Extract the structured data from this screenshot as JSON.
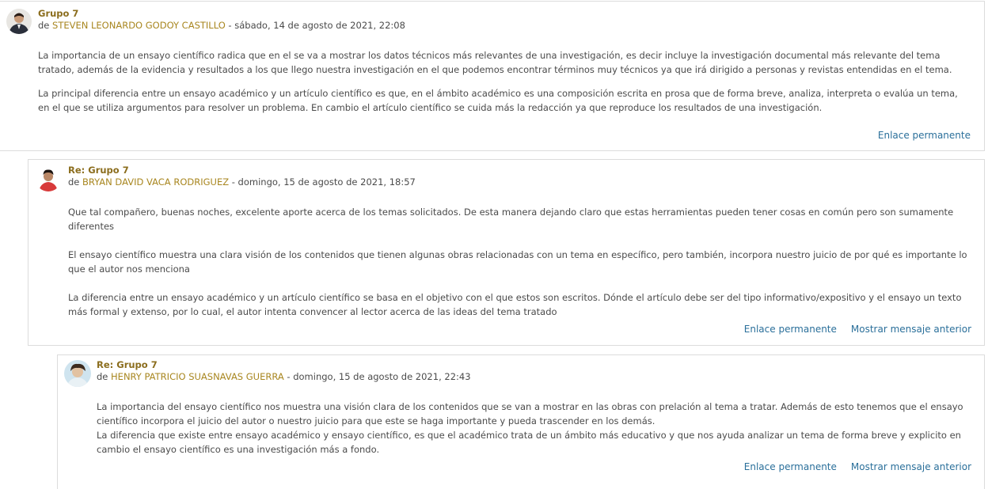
{
  "posts": [
    {
      "subject": "Grupo 7",
      "by_prefix": "de",
      "author": "STEVEN LEONARDO GODOY CASTILLO",
      "date": " - sábado, 14 de agosto de 2021, 22:08",
      "paragraphs": [
        "La importancia de un ensayo científico radica que en el se va a mostrar los datos técnicos más relevantes de una investigación, es decir incluye la investigación documental más relevante del tema tratado, además de la evidencia y resultados a los que llego nuestra investigación en el que podemos encontrar términos muy técnicos ya que irá dirigido a personas  y revistas entendidas en el tema.",
        "La principal diferencia entre un ensayo académico y un artículo científico es que, en el ámbito académico es una composición escrita en prosa que de forma breve, analiza, interpreta o evalúa un tema, en el que se utiliza argumentos para resolver un problema. En cambio el artículo científico se cuida más la redacción ya que reproduce los resultados de una investigación."
      ],
      "permalink": "Enlace permanente"
    },
    {
      "subject": "Re: Grupo 7",
      "by_prefix": "de",
      "author": "BRYAN DAVID VACA RODRIGUEZ",
      "date": " - domingo, 15 de agosto de 2021, 18:57",
      "paragraphs": [
        "Que tal compañero, buenas noches, excelente aporte acerca de los temas solicitados. De esta manera dejando claro que estas herramientas pueden tener cosas en común pero son sumamente diferentes",
        "El ensayo científico muestra una clara visión de los contenidos que tienen algunas obras relacionadas con un tema en específico, pero también, incorpora nuestro juicio de por qué es importante lo que el autor nos menciona",
        "La diferencia entre un ensayo académico y un artículo científico se basa en el objetivo con el que estos son escritos. Dónde el artículo debe ser del tipo informativo/expositivo y el ensayo un texto más formal y extenso, por lo cual, el autor intenta convencer al lector acerca de las ideas del tema tratado"
      ],
      "permalink": "Enlace permanente",
      "parent": "Mostrar mensaje anterior"
    },
    {
      "subject": "Re: Grupo 7",
      "by_prefix": "de",
      "author": "HENRY PATRICIO SUASNAVAS GUERRA",
      "date": " - domingo, 15 de agosto de 2021, 22:43",
      "paragraphs": [
        "La importancia del ensayo científico nos muestra una visión clara de los contenidos que se van a mostrar en las obras con prelación al tema a tratar. Además de esto tenemos que el ensayo científico incorpora el juicio del autor o nuestro juicio para que este se haga importante y pueda trascender en los demás.",
        "La diferencia que existe entre ensayo académico y ensayo científico, es que el académico trata de un ámbito más educativo y que nos ayuda analizar un tema de forma breve y explicito en cambio el ensayo científico es una investigación más a fondo."
      ],
      "permalink": "Enlace permanente",
      "parent": "Mostrar mensaje anterior"
    }
  ],
  "colors": {
    "link": "#2a6f9a",
    "author": "#a8861f",
    "subject": "#8b6d1d"
  }
}
